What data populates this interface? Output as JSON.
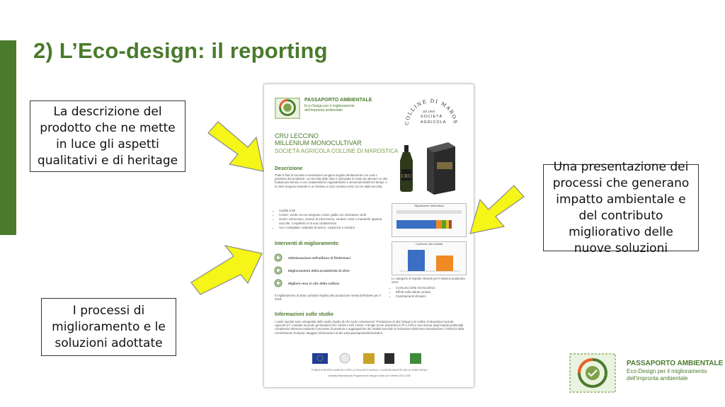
{
  "slide": {
    "title": "2) L’Eco-design: il reporting",
    "colors": {
      "accent": "#4a7a2c",
      "arrow": "#f5f518",
      "arrow_border": "#8a8a8a"
    }
  },
  "callouts": {
    "top_left": "La descrizione del prodotto che ne mette in luce gli aspetti qualitativi e di heritage",
    "right": "Una presentazione dei processi che generano impatto ambientale e del contributo migliorativo delle nuove soluzioni",
    "bottom_left": "I processi di miglioramento e le soluzioni adottate"
  },
  "document": {
    "brand_title": "PASSAPORTO AMBIENTALE",
    "brand_sub": "Eco-Design per il miglioramento dell'impronta ambientale",
    "producer_logo": {
      "arc": "COLLINE DI MAROSTICA",
      "line1": "dal 1960",
      "line2": "SOCIETÀ",
      "line3": "AGRICOLA"
    },
    "product_line1": "CRU LECCINO",
    "product_line2": "MILLENIUM MONOCULTIVAR",
    "producer": "SOCIETÀ AGRICOLA COLLINE DI MAROSTICA",
    "bottle_label": "CRU",
    "descrizione_title": "Descrizione",
    "descrizione_text": "Tutte le fasi di raccolta e lavorazione vengono seguite direttamente con cura e passione dai produttori. La raccolta delle olive è anticipata in modo da ottenere un olio fruttato più intenso e con caratteristiche organolettiche e sensoriali stabili nel tempo: e le olive vengono lavorate in un frantoio a ciclo continuo entro 24 ore dalla raccolta.",
    "bullets": [
      "Acidità 0.08",
      "Colore: verde con un elegante colore giallo con sfumature verdi",
      "Gusto: armonioso, sentori di erba fresca, verdure cotte e mandorle appena raccolte. L'equilibrio è la sua caratteristica",
      "Uso consigliato: antipasti di pesce, carpaccio e verdure"
    ],
    "chart1_title": "Ripartizione della filiera",
    "chart2_title": "Confronto dei risultati",
    "interventi_title": "Interventi di miglioramento",
    "interventi": [
      "Ottimizzazione nell'utilizzo di fitofarmaci",
      "Miglioramento della produttività di olive",
      "Migliore resa in olio della cultivar"
    ],
    "interventi_note": "Il miglioramento di stato calcolato rispetto alla produzione media dell'oliveto per il 2018.",
    "categorie_title": "Le categorie di impatto rilevanti per il sistema analizzato sono:",
    "categorie": [
      "Consumo della risorsa idrica",
      "Effetti sulla salute umana",
      "Cambiamenti climatici"
    ],
    "info_title": "Informazioni sullo studio",
    "info_text": "I valori riportati sono estrapolati dallo studio Studio di Life Cycle Assessment \"Produzione di olio biologico di Colline di Marostica Società Agricola srl\" condotto secondo gli standard ISO 14040 e ISO 14044. Il Single Score (espresso in Pt o mPt) è una misura degli impatti ambientali complessivi ottenuta mediante il processo di pesatura e aggregazione dei risultati secondo le indicazioni della Raccomandazione 179/2013 della Commissione Europea. Maggiori informazioni al sito www.passaportoambientale.it.",
    "footer1": "FONDO EUROPEO AGRICOLO PER LO SVILUPPO RURALE: L'EUROPA INVESTE NELLE ZONE RURALI",
    "footer2": "Iniziativa finanziata dal Programma di sviluppo rurale per il Veneto 2014-2020"
  },
  "corner_logo": {
    "title": "PASSAPORTO AMBIENTALE",
    "subtitle": "Eco-Design per il miglioramento dell'impronta ambientale"
  }
}
